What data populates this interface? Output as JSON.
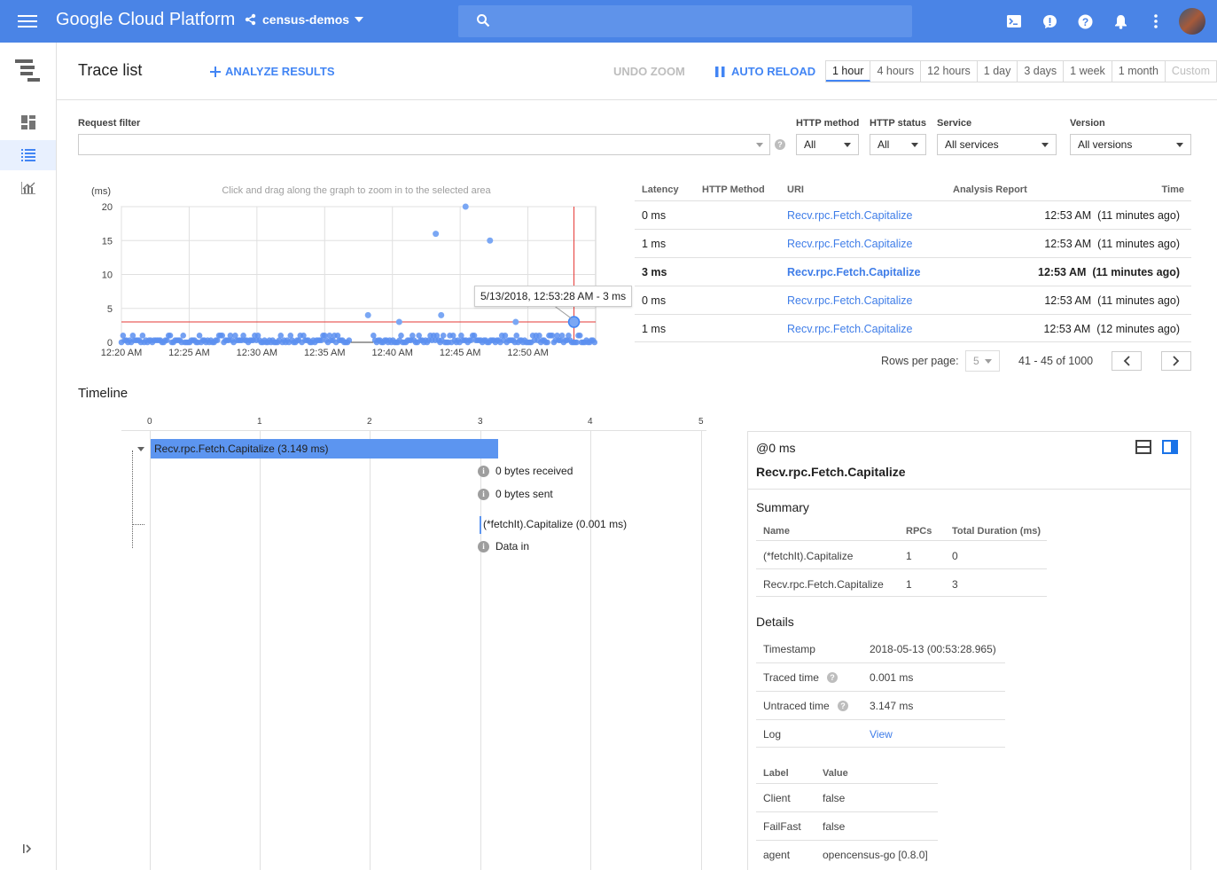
{
  "topbar": {
    "brand": "Google Cloud Platform",
    "project": "census-demos",
    "search_placeholder": "",
    "icons": [
      "cloud-shell-icon",
      "feedback-icon",
      "help-icon",
      "notifications-icon",
      "more-vert-icon",
      "avatar"
    ]
  },
  "header": {
    "title": "Trace list",
    "analyze": "ANALYZE RESULTS",
    "undo_zoom": "UNDO ZOOM",
    "auto_reload": "AUTO RELOAD",
    "ranges": [
      "1 hour",
      "4 hours",
      "12 hours",
      "1 day",
      "3 days",
      "1 week",
      "1 month",
      "Custom"
    ],
    "selected_range": "1 hour"
  },
  "filters": {
    "request_filter_label": "Request filter",
    "request_filter_value": "",
    "http_method_label": "HTTP method",
    "http_method_value": "All",
    "http_status_label": "HTTP status",
    "http_status_value": "All",
    "service_label": "Service",
    "service_value": "All services",
    "version_label": "Version",
    "version_value": "All versions"
  },
  "chart_data": {
    "type": "scatter",
    "ylabel": "(ms)",
    "hint": "Click and drag along the graph to zoom in to the selected area",
    "y_ticks": [
      "20",
      "15",
      "10",
      "5",
      "0"
    ],
    "ylim": [
      0,
      20
    ],
    "x_ticks": [
      "12:20 AM",
      "12:25 AM",
      "12:30 AM",
      "12:35 AM",
      "12:40 AM",
      "12:45 AM",
      "12:50 AM"
    ],
    "xlim_minutes": [
      0,
      35
    ],
    "outliers": [
      {
        "t": 23.2,
        "ms": 16
      },
      {
        "t": 25.4,
        "ms": 20
      },
      {
        "t": 27.2,
        "ms": 15
      },
      {
        "t": 23.6,
        "ms": 4
      },
      {
        "t": 20.5,
        "ms": 3
      },
      {
        "t": 18.2,
        "ms": 4
      },
      {
        "t": 29.1,
        "ms": 3
      }
    ],
    "highlight": {
      "t": 33.4,
      "ms": 3,
      "label": "5/13/2018, 12:53:28 AM - 3 ms"
    },
    "dense_ranges": [
      [
        0,
        16.8
      ],
      [
        18.6,
        35
      ]
    ]
  },
  "table": {
    "headers": [
      "Latency",
      "HTTP Method",
      "URI",
      "Analysis Report",
      "Time"
    ],
    "rows": [
      {
        "latency": "0 ms",
        "uri": "Recv.rpc.Fetch.Capitalize",
        "time": "12:53 AM  (11 minutes ago)"
      },
      {
        "latency": "1 ms",
        "uri": "Recv.rpc.Fetch.Capitalize",
        "time": "12:53 AM  (11 minutes ago)"
      },
      {
        "latency": "3 ms",
        "uri": "Recv.rpc.Fetch.Capitalize",
        "time": "12:53 AM  (11 minutes ago)"
      },
      {
        "latency": "0 ms",
        "uri": "Recv.rpc.Fetch.Capitalize",
        "time": "12:53 AM  (11 minutes ago)"
      },
      {
        "latency": "1 ms",
        "uri": "Recv.rpc.Fetch.Capitalize",
        "time": "12:53 AM  (12 minutes ago)"
      }
    ],
    "rows_per_page_label": "Rows per page:",
    "rows_per_page": "5",
    "range_text": "41 - 45 of 1000"
  },
  "timeline": {
    "title": "Timeline",
    "axis": [
      "0",
      "1",
      "2",
      "3",
      "4",
      "5"
    ],
    "span_label": "Recv.rpc.Fetch.Capitalize (3.149 ms)",
    "annotations": [
      "0 bytes received",
      "0 bytes sent"
    ],
    "child_span": "(*fetchIt).Capitalize (0.001 ms)",
    "child_annotation": "Data in"
  },
  "detail": {
    "at": "@0 ms",
    "name": "Recv.rpc.Fetch.Capitalize",
    "summary_title": "Summary",
    "summary_headers": [
      "Name",
      "RPCs",
      "Total Duration (ms)"
    ],
    "summary_rows": [
      {
        "name": "(*fetchIt).Capitalize",
        "rpcs": "1",
        "dur": "0"
      },
      {
        "name": "Recv.rpc.Fetch.Capitalize",
        "rpcs": "1",
        "dur": "3"
      }
    ],
    "details_title": "Details",
    "details": [
      {
        "k": "Timestamp",
        "v": "2018-05-13 (00:53:28.965)"
      },
      {
        "k": "Traced time",
        "v": "0.001 ms"
      },
      {
        "k": "Untraced time",
        "v": "3.147 ms"
      },
      {
        "k": "Log",
        "v": "View"
      }
    ],
    "label_headers": [
      "Label",
      "Value"
    ],
    "labels": [
      {
        "k": "Client",
        "v": "false"
      },
      {
        "k": "FailFast",
        "v": "false"
      },
      {
        "k": "agent",
        "v": "opencensus-go [0.8.0]"
      }
    ]
  }
}
